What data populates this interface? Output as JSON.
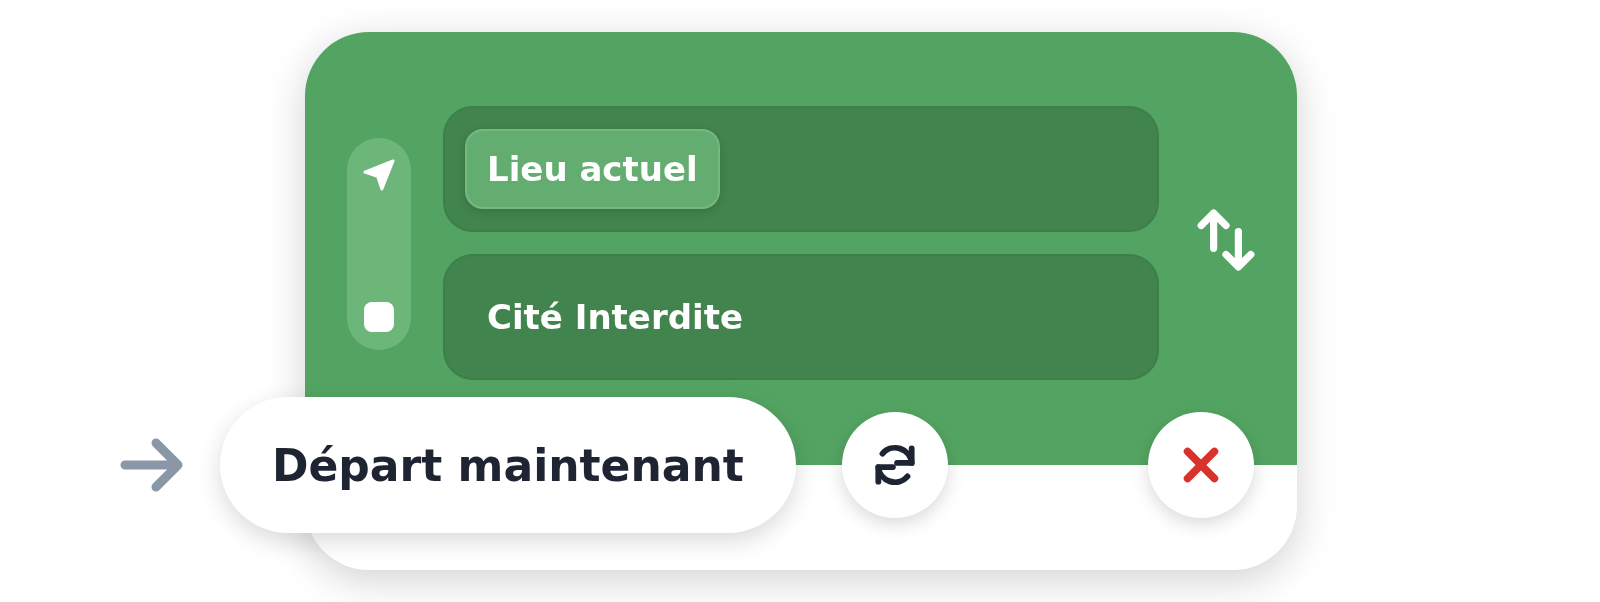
{
  "route": {
    "origin": {
      "label": "Lieu actuel",
      "kind": "chip"
    },
    "destination": {
      "label": "Cité Interdite",
      "kind": "text"
    }
  },
  "departure": {
    "label": "Départ maintenant"
  }
}
